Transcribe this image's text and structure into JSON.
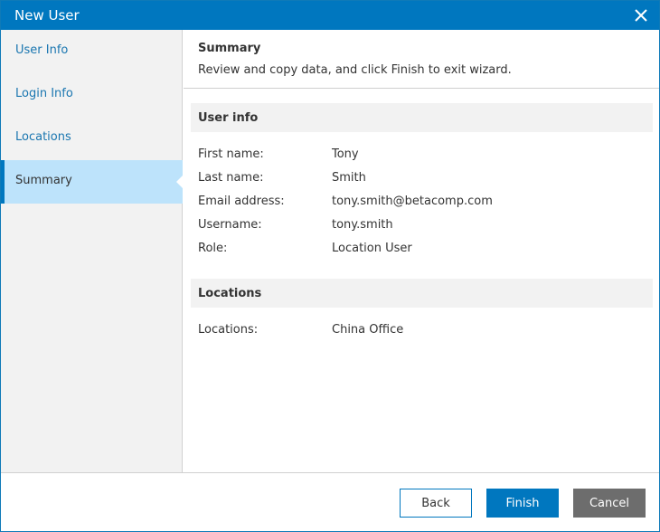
{
  "window": {
    "title": "New User"
  },
  "sidebar": {
    "items": [
      {
        "label": "User Info"
      },
      {
        "label": "Login Info"
      },
      {
        "label": "Locations"
      },
      {
        "label": "Summary"
      }
    ]
  },
  "header": {
    "title": "Summary",
    "description": "Review and copy data, and click Finish to exit wizard."
  },
  "summary": {
    "user_info_heading": "User info",
    "fields": [
      {
        "key": "First name:",
        "value": "Tony"
      },
      {
        "key": "Last name:",
        "value": "Smith"
      },
      {
        "key": "Email address:",
        "value": "tony.smith@betacomp.com"
      },
      {
        "key": "Username:",
        "value": "tony.smith"
      },
      {
        "key": "Role:",
        "value": "Location User"
      }
    ],
    "locations_heading": "Locations",
    "locations": {
      "key": "Locations:",
      "value": "China Office"
    }
  },
  "footer": {
    "back_label": "Back",
    "finish_label": "Finish",
    "cancel_label": "Cancel"
  },
  "colors": {
    "accent": "#0077bf",
    "active_nav": "#bde3fb",
    "cancel_button": "#6d6d6d"
  }
}
